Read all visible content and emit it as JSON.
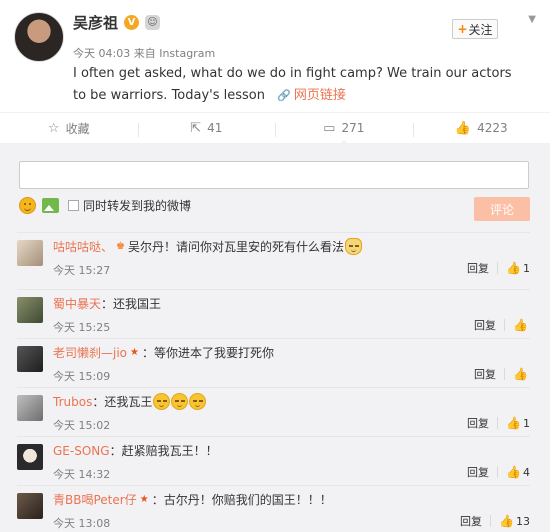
{
  "post": {
    "author": "吴彦祖",
    "time": "今天 04:03",
    "source_prefix": "来自",
    "source": "Instagram",
    "follow_label": "关注",
    "text": "I often get asked, what do we do in fight camp? We train our actors to be warriors. Today's lesson",
    "link_label": "网页链接"
  },
  "toolbar": {
    "favorite_label": "收藏",
    "repost_count": "41",
    "comment_count": "271",
    "like_count": "4223"
  },
  "composer": {
    "repost_label": "同时转发到我的微博",
    "submit_label": "评论"
  },
  "comments": [
    {
      "user": "咕咕咕哒、",
      "text": "吴尔丹！请问你对瓦里安的死有什么看法",
      "time": "今天 15:27",
      "reply": "回复",
      "likes": "1",
      "badge": "crown",
      "emoji": "doge"
    },
    {
      "user": "蜀中暴天",
      "text": "：还我国王",
      "time": "今天 15:25",
      "reply": "回复",
      "likes": "",
      "badge": "",
      "emoji": ""
    },
    {
      "user": "老司懒刹—jio",
      "text": "：等你进本了我要打死你",
      "time": "今天 15:09",
      "reply": "回复",
      "likes": "",
      "badge": "star",
      "emoji": ""
    },
    {
      "user": "Trubos",
      "text": "：还我瓦王",
      "time": "今天 15:02",
      "reply": "回复",
      "likes": "1",
      "badge": "",
      "emoji": "sad3"
    },
    {
      "user": "GE-SONG",
      "text": "：赶紧赔我瓦王！！",
      "time": "今天 14:32",
      "reply": "回复",
      "likes": "4",
      "badge": "",
      "emoji": ""
    },
    {
      "user": "青BB喝Peter仔",
      "text": "：古尔丹！你赔我们的国王！！！",
      "time": "今天 13:08",
      "reply": "回复",
      "likes": "13",
      "badge": "star",
      "emoji": ""
    }
  ],
  "colors": {
    "accent": "#eb7350",
    "submit_bg": "#fbbfa6",
    "comment_bg": "#f2f2f5"
  }
}
